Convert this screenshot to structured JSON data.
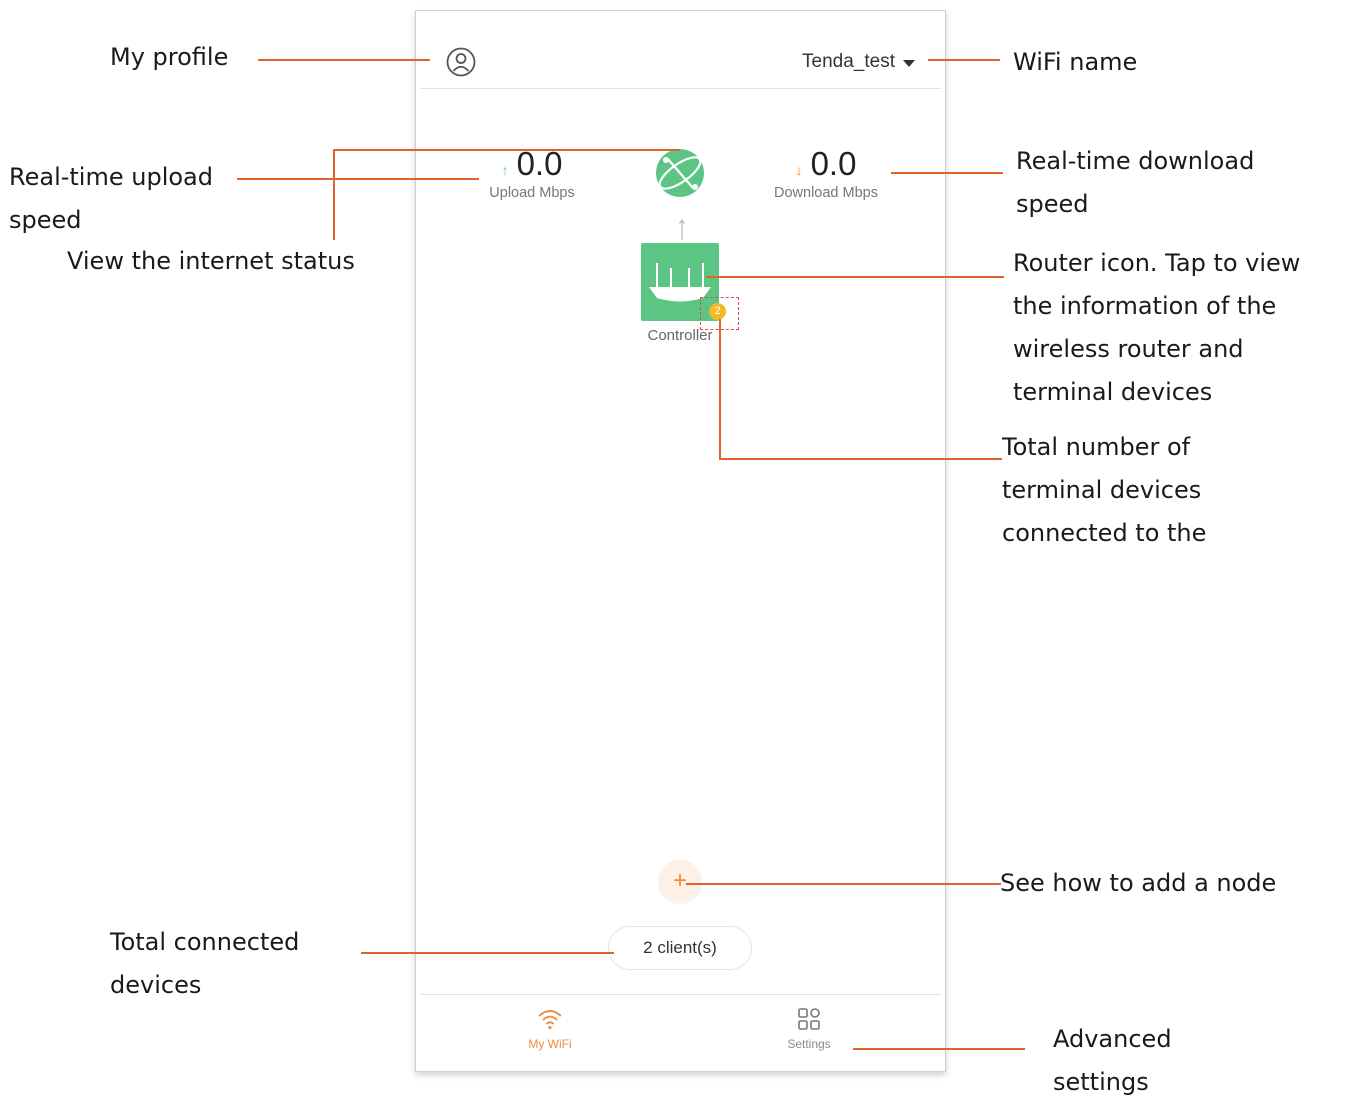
{
  "app": {
    "wifi_name": "Tenda_test",
    "upload": {
      "value": "0.0",
      "label": "Upload Mbps"
    },
    "download": {
      "value": "0.0",
      "label": "Download Mbps"
    },
    "router": {
      "label": "Controller",
      "badge_count": "2"
    },
    "add_node_glyph": "+",
    "clients_label": "2 client(s)",
    "tabs": [
      {
        "label": "My WiFi",
        "icon": "wifi-icon",
        "active": true
      },
      {
        "label": "Settings",
        "icon": "grid-icon",
        "active": false
      }
    ]
  },
  "colors": {
    "accent": "#f08a3c",
    "router_green": "#5cc584",
    "badge": "#f5b82a",
    "annotation_line": "#e2622b"
  },
  "annotations": {
    "my_profile": "My profile",
    "wifi_name": "WiFi name",
    "upload_speed": "Real-time upload\nspeed",
    "internet_status": "View the internet status",
    "download_speed": "Real-time download\nspeed",
    "router_icon": "Router icon. Tap to view\nthe information of the\nwireless router and\nterminal devices",
    "terminal_total": "Total number of\nterminal devices\nconnected to the",
    "add_node": "See how to add a node",
    "total_connected": "Total connected\ndevices",
    "advanced_settings": "Advanced\nsettings"
  }
}
